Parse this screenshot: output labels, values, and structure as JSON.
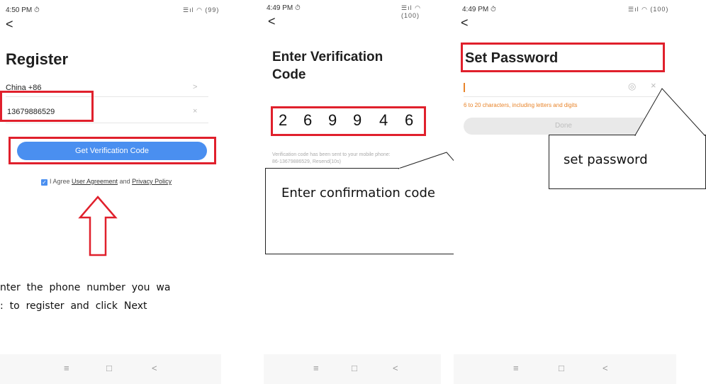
{
  "screen1": {
    "status_time": "4:50 PM ⏱",
    "status_right": "☰ıl ◠ (99)",
    "back": "<",
    "title": "Register",
    "country": "China +86",
    "chevron": ">",
    "phone": "13679886529",
    "clear": "×",
    "button": "Get Verification Code",
    "agree_prefix": "I Agree ",
    "user_agreement": "User Agreement",
    "and": " and ",
    "privacy_policy": "Privacy Policy",
    "caption_line1": "nter  the  phone  number  you  wa",
    "caption_line2": ":  to  register  and  click  Next"
  },
  "screen2": {
    "status_time": "4:49 PM ⏱",
    "status_right": "☰ıl ◠ (100)",
    "back": "<",
    "title_line1": "Enter Verification",
    "title_line2": "Code",
    "digits": [
      "2",
      "6",
      "9",
      "9",
      "4",
      "6"
    ],
    "hint_line1": "Verification code has been sent to your mobile phone:",
    "hint_line2": "86-13679886529, Resend(10s)",
    "callout": "Enter confirmation code"
  },
  "screen3": {
    "status_time": "4:49 PM ⏱",
    "status_right": "☰ıl ◠ (100)",
    "back": "<",
    "title": "Set Password",
    "eye": "◎",
    "clear": "×",
    "hint": "6 to 20 characters, including letters and digits",
    "done": "Done",
    "callout": "set password"
  },
  "nav": {
    "menu": "≡",
    "home": "□",
    "back": "<"
  },
  "colors": {
    "accent_blue": "#4a8ff0",
    "highlight_red": "#e0202c",
    "hint_orange": "#e8842a"
  }
}
